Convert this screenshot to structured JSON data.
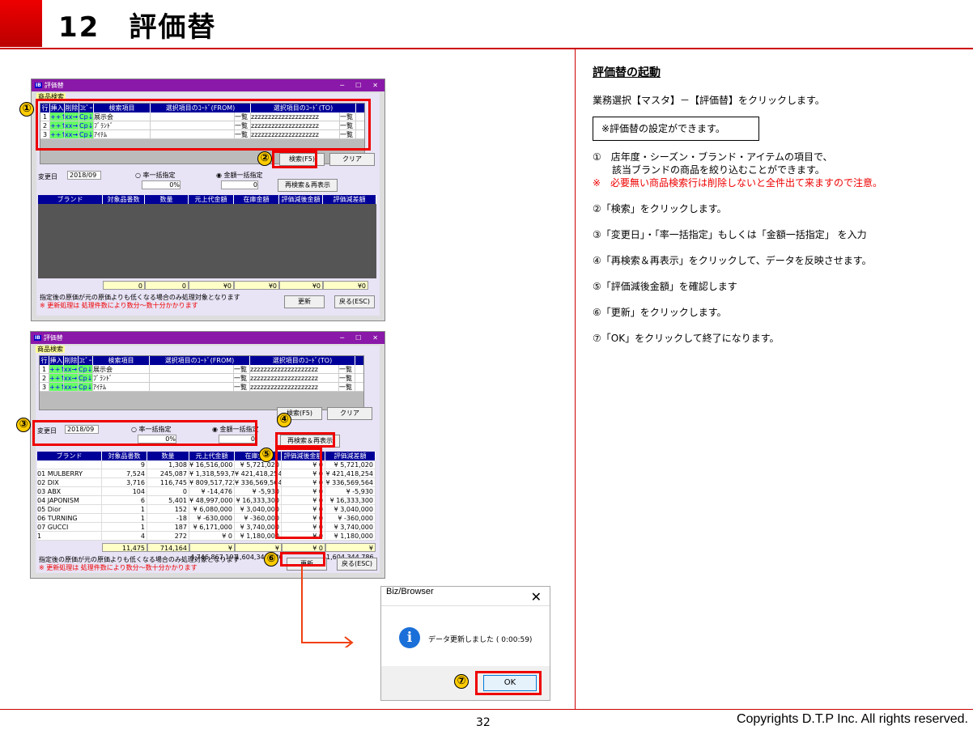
{
  "header": {
    "number": "12",
    "title": "評価替"
  },
  "footer": {
    "page": "32",
    "copyright": "Copyrights  D.T.P Inc. All rights reserved."
  },
  "right": {
    "heading": "評価替の起動",
    "p1": "業務選択【マスタ】－【評価替】をクリックします。",
    "note": "※評価替の設定ができます。",
    "step1a": "①　店年度・シーズン・ブランド・アイテムの項目で、",
    "step1b": "　　該当ブランドの商品を絞り込むことができます。",
    "warn": "※　必要無い商品検索行は削除しないと全件出て来ますので注意。",
    "step2": "②「検索」をクリックします。",
    "step3": "③「変更日」・「率一括指定」もしくは「金額一括指定」 を入力",
    "step4": "④「再検索＆再表示」をクリックして、データを反映させます。",
    "step5": "⑤「評価減後金額」を確認します",
    "step6": "⑥「更新」をクリックします。",
    "step7": "⑦「OK」をクリックして終了になります。"
  },
  "window": {
    "title": "評価替",
    "icon": "IB",
    "tab": "商品検索",
    "cols": [
      "行",
      "挿入",
      "削除",
      "ｺﾋﾟｰ",
      "検索項目",
      "選択項目のｺｰﾄﾞ(FROM)",
      "選択項目のｺｰﾄﾞ(TO)"
    ],
    "rows": [
      {
        "n": "1",
        "item": "展示会",
        "to": "zzzzzzzzzzzzzzzzzzzz"
      },
      {
        "n": "2",
        "item": "ﾌﾞﾗﾝﾄﾞ",
        "to": "zzzzzzzzzzzzzzzzzzzz"
      },
      {
        "n": "3",
        "item": "ｱｲﾃﾑ",
        "to": "zzzzzzzzzzzzzzzzzzzz"
      }
    ],
    "ins": "++↑",
    "del": "xx→",
    "cp": "Cp↓",
    "list_btn": "一覧",
    "search_btn": "検索(F5)",
    "clear_btn": "クリア",
    "date_label": "変更日",
    "date": "2018/09",
    "rate_label": "率一括指定",
    "amount_label": "金額一括指定",
    "rate_val": "0%",
    "amount_val": "0",
    "research_btn": "再検索＆再表示",
    "cols2": [
      "ブランド",
      "対象品番数",
      "数量",
      "元上代金額",
      "在庫金額",
      "評価減後金額",
      "評価減差額"
    ],
    "tot_empty": [
      "0",
      "0",
      "¥0",
      "¥0",
      "¥0",
      "¥0"
    ],
    "data": [
      [
        "",
        "9",
        "1,308",
        "¥ 16,516,000",
        "¥ 5,721,020",
        "¥ 0",
        "¥ 5,721,020"
      ],
      [
        "01 MULBERRY",
        "7,524",
        "245,087",
        "¥ 1,318,593,787",
        "¥ 421,418,254",
        "¥ 0",
        "¥ 421,418,254"
      ],
      [
        "02 DIX",
        "3,716",
        "116,745",
        "¥ 809,517,722",
        "¥ 336,569,564",
        "¥ 0",
        "¥ 336,569,564"
      ],
      [
        "03 ABX",
        "104",
        "0",
        "¥ -14,476",
        "¥ -5,930",
        "¥ 0",
        "¥ -5,930"
      ],
      [
        "04 JAPONISM",
        "6",
        "5,401",
        "¥ 48,997,000",
        "¥ 16,333,300",
        "¥ 0",
        "¥ 16,333,300"
      ],
      [
        "05 Dior",
        "1",
        "152",
        "¥ 6,080,000",
        "¥ 3,040,000",
        "¥ 0",
        "¥ 3,040,000"
      ],
      [
        "06 TURNING",
        "1",
        "-18",
        "¥ -630,000",
        "¥ -360,000",
        "¥ 0",
        "¥ -360,000"
      ],
      [
        "07 GUCCI",
        "1",
        "187",
        "¥ 6,171,000",
        "¥ 3,740,000",
        "¥ 0",
        "¥ 3,740,000"
      ],
      [
        "1",
        "4",
        "272",
        "¥ 0",
        "¥ 1,180,000",
        "¥ 0",
        "¥ 1,180,000"
      ]
    ],
    "tot": [
      "11,475",
      "714,164",
      "¥ 4,746,867,191",
      "¥ 1,604,344,786",
      "¥ 0",
      "¥ 1,604,344,786"
    ],
    "note1": "指定後の原価が元の原価よりも低くなる場合のみ処理対象となります",
    "note2": "※ 更新処理は 処理件数により数分～数十分かかります",
    "update_btn": "更新",
    "back_btn": "戻る(ESC)"
  },
  "dialog": {
    "title": "Biz/Browser",
    "msg": "データ更新しました ( 0:00:59)",
    "ok": "OK"
  },
  "marks": {
    "m1": "①",
    "m2": "②",
    "m3": "③",
    "m4": "④",
    "m5": "⑤",
    "m6": "⑥",
    "m7": "⑦"
  }
}
